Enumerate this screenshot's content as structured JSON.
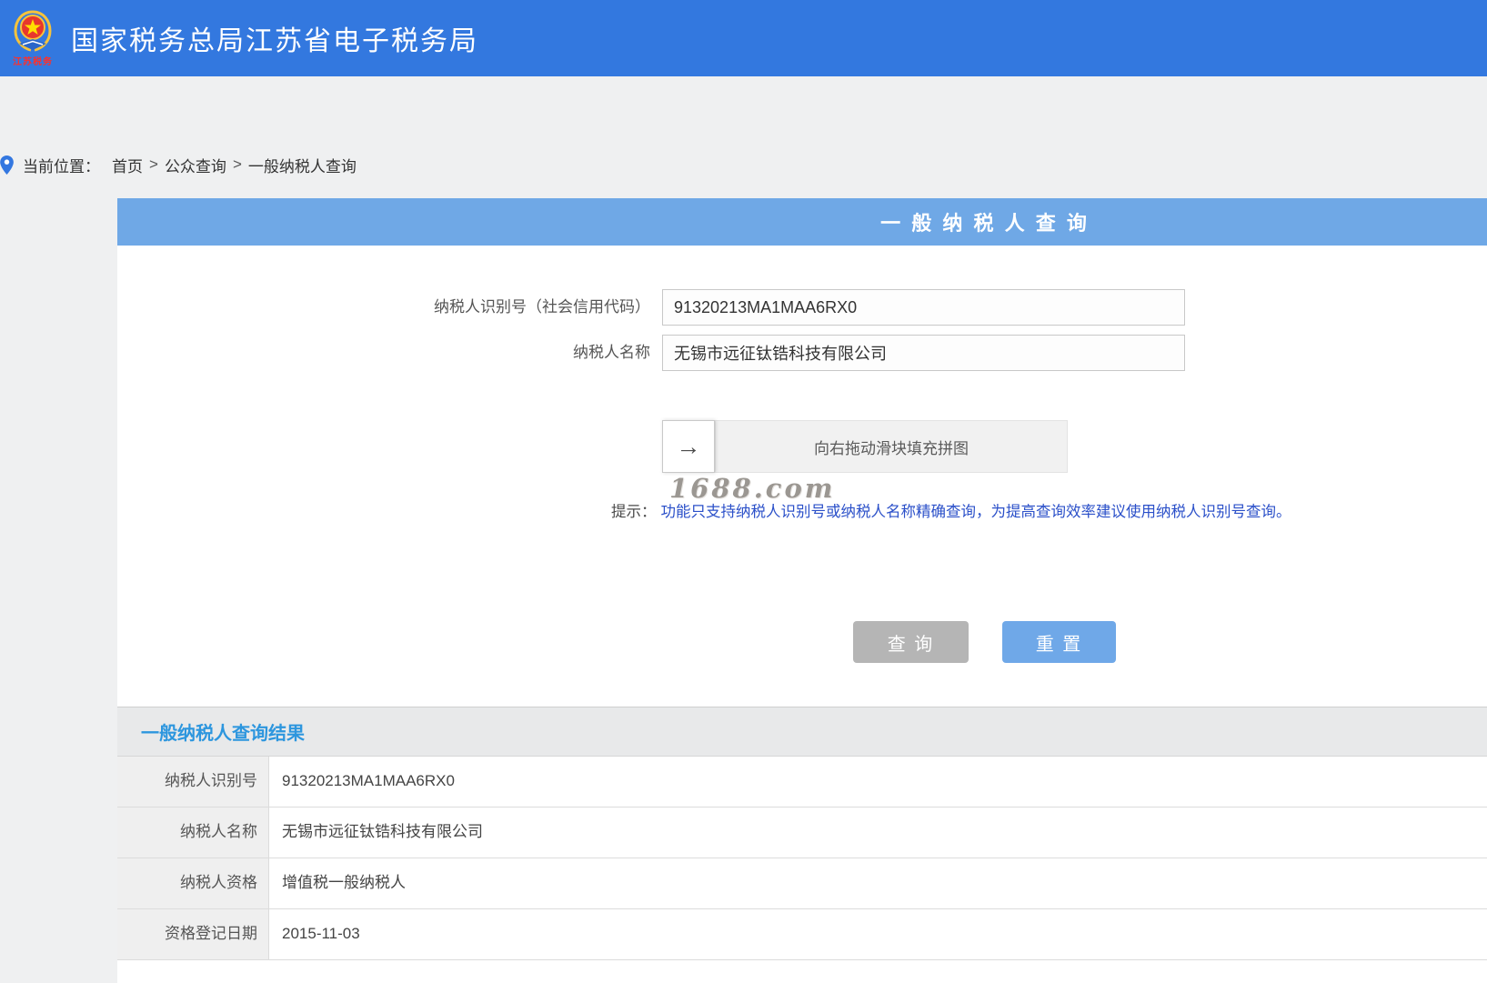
{
  "header": {
    "title": "国家税务总局江苏省电子税务局",
    "logo_text": "江苏税务"
  },
  "breadcrumb": {
    "label": "当前位置：",
    "separator": ">",
    "items": [
      "首页",
      "公众查询",
      "一般纳税人查询"
    ]
  },
  "panel": {
    "band_title": "一 般 纳 税 人 查 询"
  },
  "form": {
    "taxpayer_id": {
      "label": "纳税人识别号（社会信用代码）",
      "value": "91320213MA1MAA6RX0"
    },
    "taxpayer_name": {
      "label": "纳税人名称",
      "value": "无锡市远征钛锆科技有限公司"
    },
    "slider": {
      "arrow_icon": "→",
      "text": "向右拖动滑块填充拼图"
    },
    "watermark": "1688.com",
    "tip_label": "提示：",
    "tip_text": "功能只支持纳税人识别号或纳税人名称精确查询，为提高查询效率建议使用纳税人识别号查询。",
    "query_button": "查 询",
    "reset_button": "重 置"
  },
  "results": {
    "title": "一般纳税人查询结果",
    "rows": [
      {
        "label": "纳税人识别号",
        "value": "91320213MA1MAA6RX0"
      },
      {
        "label": "纳税人名称",
        "value": "无锡市远征钛锆科技有限公司"
      },
      {
        "label": "纳税人资格",
        "value": "增值税一般纳税人"
      },
      {
        "label": "资格登记日期",
        "value": "2015-11-03"
      }
    ]
  },
  "colors": {
    "header_bg": "#3378df",
    "band_bg": "#6fa8e6",
    "query_button_bg": "#b5b5b5",
    "reset_button_bg": "#6fa8e8",
    "results_title": "#2d96de",
    "tip_text": "#2b50c9",
    "logo_red": "#e8372c"
  }
}
